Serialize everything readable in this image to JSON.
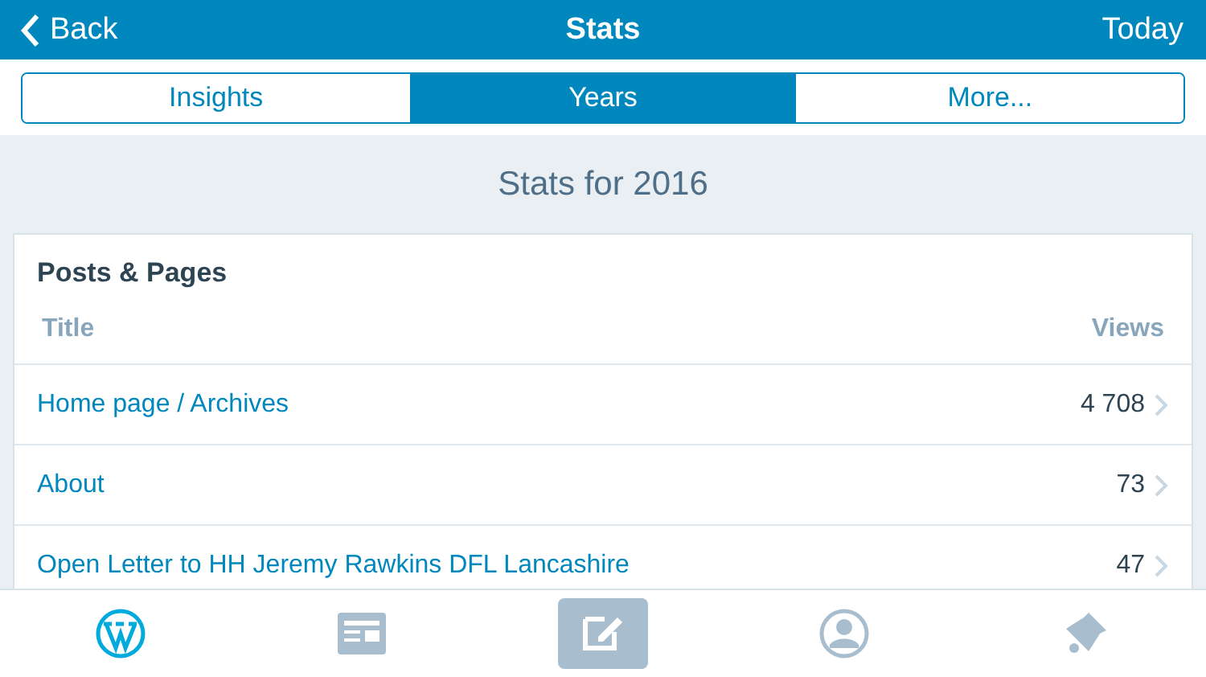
{
  "nav_bar": {
    "back": "Back",
    "title": "Stats",
    "action": "Today"
  },
  "segments": [
    {
      "label": "Insights",
      "selected": false
    },
    {
      "label": "Years",
      "selected": true
    },
    {
      "label": "More...",
      "selected": false
    }
  ],
  "heading": "Stats for 2016",
  "card": {
    "title": "Posts & Pages",
    "columns": [
      "Title",
      "Views"
    ],
    "rows": [
      {
        "title": "Home page / Archives",
        "views": "4 708"
      },
      {
        "title": "About",
        "views": "73"
      },
      {
        "title": "Open Letter to HH Jeremy Rawkins DFL Lancashire",
        "views": "47"
      }
    ]
  },
  "tab_bar": [
    {
      "kind": "site",
      "selected": true
    },
    {
      "kind": "reader",
      "selected": false
    },
    {
      "kind": "compose",
      "selected": false
    },
    {
      "kind": "me",
      "selected": false
    },
    {
      "kind": "notifications",
      "selected": false
    }
  ]
}
